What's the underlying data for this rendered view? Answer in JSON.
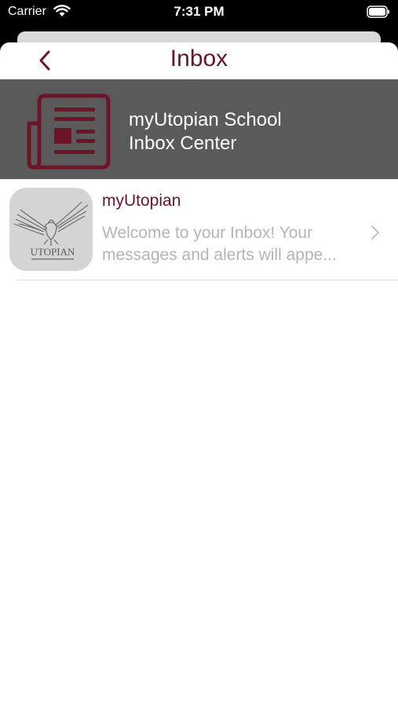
{
  "status_bar": {
    "carrier": "Carrier",
    "time": "7:31 PM",
    "wifi_icon": "wifi-icon",
    "battery_icon": "battery-icon"
  },
  "nav": {
    "title": "Inbox",
    "back_icon": "chevron-left-icon"
  },
  "banner": {
    "icon": "newspaper-icon",
    "title_line1": "myUtopian School",
    "title_line2": "Inbox Center"
  },
  "messages": [
    {
      "sender": "myUtopian",
      "preview_line1": "Welcome to your Inbox! Your",
      "preview_line2": "messages and alerts will appe...",
      "avatar_logo_text": "UTOPIAN",
      "avatar_logo_icon": "eagle-logo-icon"
    }
  ],
  "colors": {
    "accent": "#6e1428",
    "banner_bg": "#5a5a5a",
    "preview_text": "#b5b5b5"
  }
}
